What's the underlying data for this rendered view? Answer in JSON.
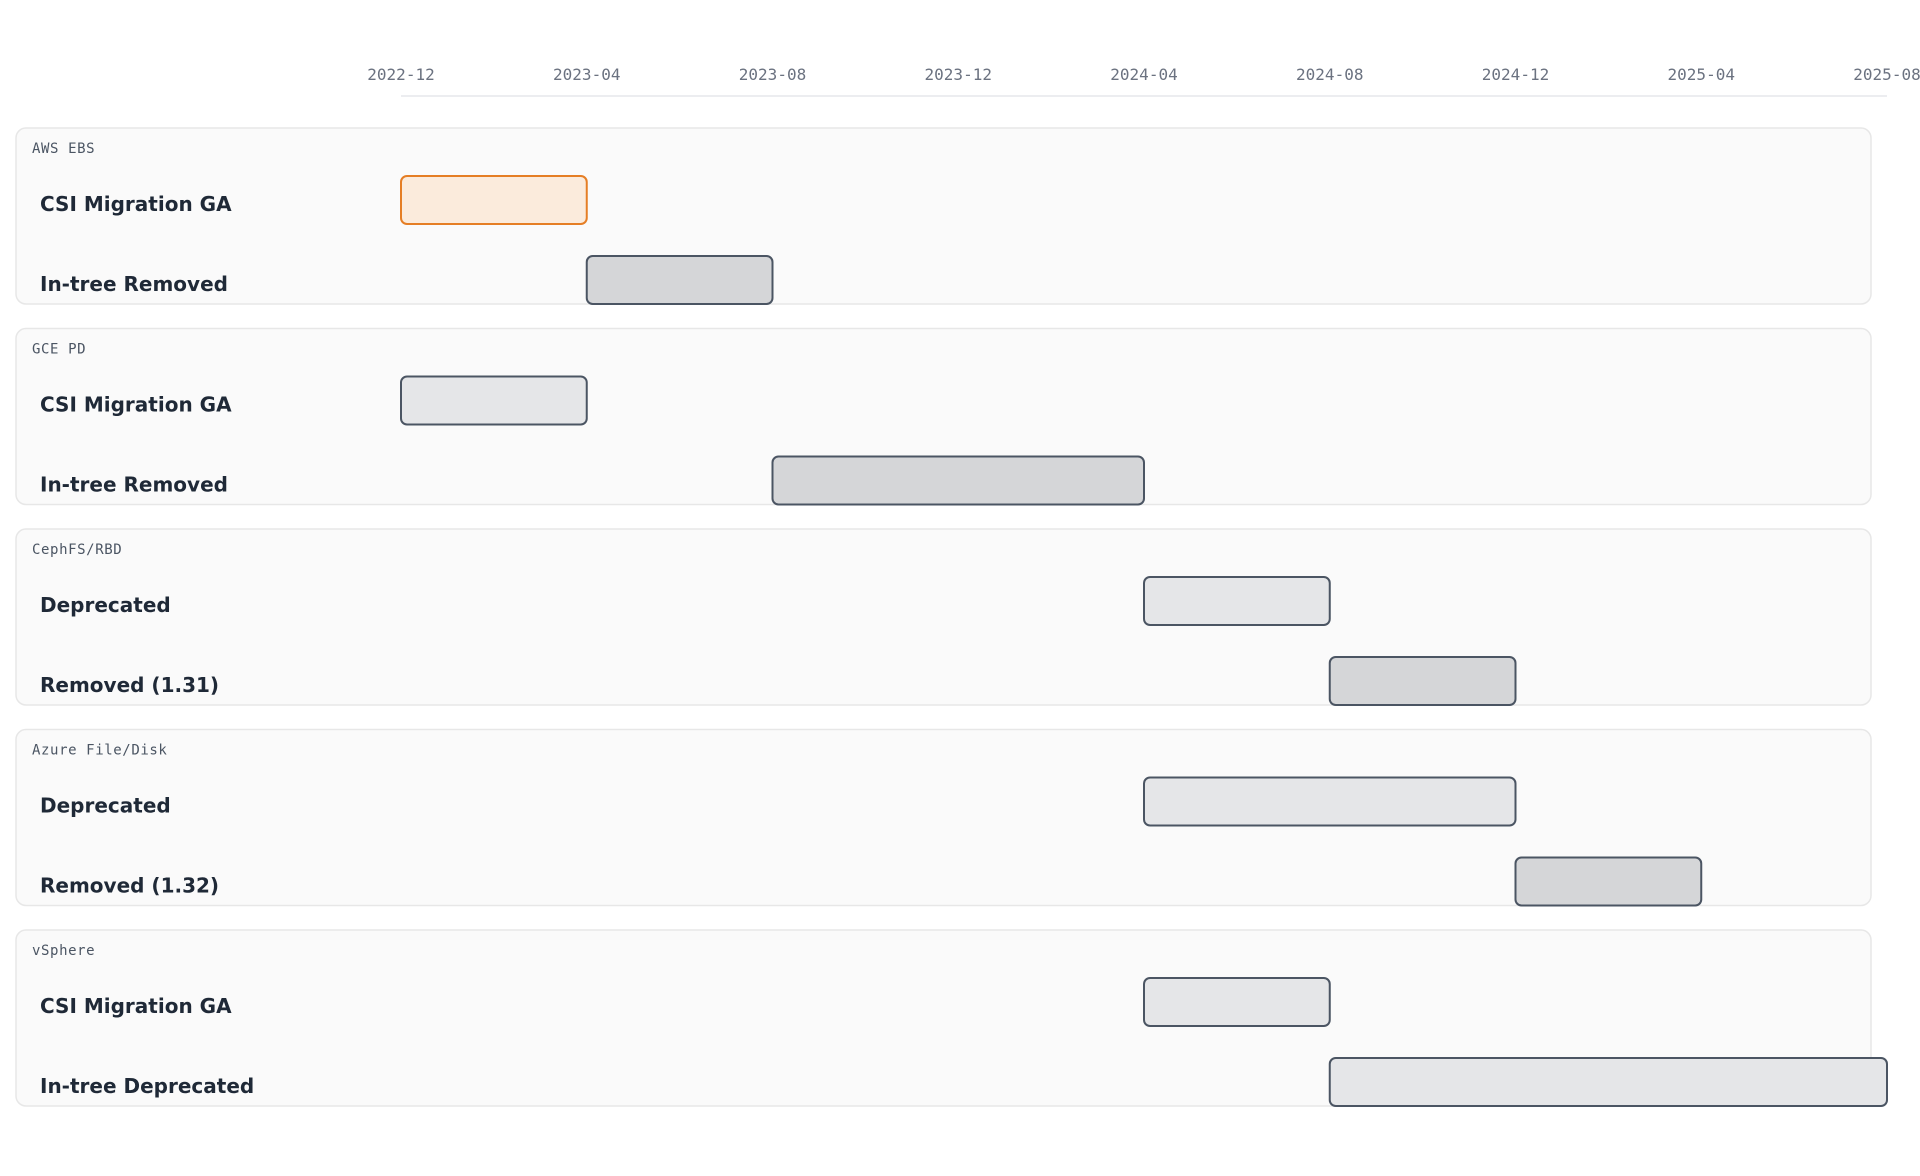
{
  "chart_data": {
    "type": "gantt",
    "title": "",
    "x_axis": {
      "ticks": [
        "2022-12",
        "2023-04",
        "2023-08",
        "2023-12",
        "2024-04",
        "2024-08",
        "2024-12",
        "2025-04",
        "2025-08"
      ],
      "range": [
        "2022-12",
        "2025-08"
      ]
    },
    "colors": {
      "highlight_fill": "#fbebdc",
      "highlight_stroke": "#e57e25",
      "light_fill": "#e5e6e8",
      "dark_fill": "#d5d6d8",
      "bar_stroke": "#4b5563"
    },
    "groups": [
      {
        "name": "AWS EBS",
        "rows": [
          {
            "label": "CSI Migration GA",
            "start": "2022-12",
            "end": "2023-04",
            "style": "highlight"
          },
          {
            "label": "In-tree Removed",
            "start": "2023-04",
            "end": "2023-08",
            "style": "dark"
          }
        ]
      },
      {
        "name": "GCE PD",
        "rows": [
          {
            "label": "CSI Migration GA",
            "start": "2022-12",
            "end": "2023-04",
            "style": "light"
          },
          {
            "label": "In-tree Removed",
            "start": "2023-08",
            "end": "2024-04",
            "style": "dark"
          }
        ]
      },
      {
        "name": "CephFS/RBD",
        "rows": [
          {
            "label": "Deprecated",
            "start": "2024-04",
            "end": "2024-08",
            "style": "light"
          },
          {
            "label": "Removed (1.31)",
            "start": "2024-08",
            "end": "2024-12",
            "style": "dark"
          }
        ]
      },
      {
        "name": "Azure File/Disk",
        "rows": [
          {
            "label": "Deprecated",
            "start": "2024-04",
            "end": "2024-12",
            "style": "light"
          },
          {
            "label": "Removed (1.32)",
            "start": "2024-12",
            "end": "2025-04",
            "style": "dark"
          }
        ]
      },
      {
        "name": "vSphere",
        "rows": [
          {
            "label": "CSI Migration GA",
            "start": "2024-04",
            "end": "2024-08",
            "style": "light"
          },
          {
            "label": "In-tree Deprecated",
            "start": "2024-08",
            "end": "2025-08",
            "style": "light"
          }
        ]
      }
    ]
  }
}
